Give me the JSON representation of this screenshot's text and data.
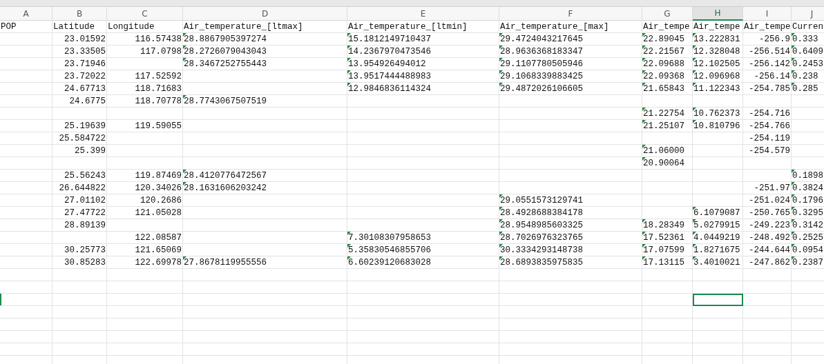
{
  "columns": [
    {
      "letter": "A",
      "heading": "POP",
      "text_numbers": false,
      "selected": false
    },
    {
      "letter": "B",
      "heading": "Latitude",
      "text_numbers": false,
      "selected": false
    },
    {
      "letter": "C",
      "heading": "Longitude",
      "text_numbers": false,
      "selected": false
    },
    {
      "letter": "D",
      "heading": "Air_temperature_[ltmax]",
      "text_numbers": true,
      "selected": false
    },
    {
      "letter": "E",
      "heading": "Air_temperature_[ltmin]",
      "text_numbers": true,
      "selected": false
    },
    {
      "letter": "F",
      "heading": "Air_temperature_[max]",
      "text_numbers": true,
      "selected": false
    },
    {
      "letter": "G",
      "heading": "Air_tempe",
      "text_numbers": true,
      "selected": false
    },
    {
      "letter": "H",
      "heading": "Air_tempe",
      "text_numbers": true,
      "selected": true
    },
    {
      "letter": "I",
      "heading": "Air_tempe",
      "text_numbers": false,
      "selected": false
    },
    {
      "letter": "J",
      "heading": "Curren",
      "text_numbers": true,
      "selected": false
    }
  ],
  "rows": [
    [
      null,
      "23.01592",
      "116.57438",
      "28.8867905397274",
      "15.1812149710437",
      "29.4724043217645",
      "22.89045",
      "13.222831",
      "-256.9",
      "0.333"
    ],
    [
      null,
      "23.33505",
      "117.0798",
      "28.2726079043043",
      "14.2367970473546",
      "28.9636368183347",
      "22.21567",
      "12.328048",
      "-256.514",
      "0.6409"
    ],
    [
      null,
      "23.71946",
      null,
      "28.3467252755443",
      "13.954926494012",
      "29.1107780505946",
      "22.09688",
      "12.102505",
      "-256.142",
      "0.2453"
    ],
    [
      null,
      "23.72022",
      "117.52592",
      null,
      "13.9517444488983",
      "29.1068339883425",
      "22.09368",
      "12.096968",
      "-256.14",
      "0.238"
    ],
    [
      null,
      "24.67713",
      "118.71683",
      null,
      "12.9846836114324",
      "29.4872026106605",
      "21.65843",
      "11.122343",
      "-254.785",
      "0.285"
    ],
    [
      null,
      "24.6775",
      "118.70778",
      "28.7743067507519",
      null,
      null,
      null,
      null,
      null,
      null
    ],
    [
      null,
      null,
      null,
      null,
      null,
      null,
      "21.22754",
      "10.762373",
      "-254.716",
      null
    ],
    [
      null,
      "25.19639",
      "119.59055",
      null,
      null,
      null,
      "21.25107",
      "10.810796",
      "-254.766",
      null
    ],
    [
      null,
      "25.584722",
      null,
      null,
      null,
      null,
      null,
      null,
      "-254.119",
      null
    ],
    [
      null,
      "25.399",
      null,
      null,
      null,
      null,
      "21.06000",
      null,
      "-254.579",
      null
    ],
    [
      null,
      null,
      null,
      null,
      null,
      null,
      "20.90064",
      null,
      null,
      null
    ],
    [
      null,
      "25.56243",
      "119.87469",
      "28.4120776472567",
      null,
      null,
      null,
      null,
      null,
      "0.1898"
    ],
    [
      null,
      "26.644822",
      "120.34026",
      "28.1631606203242",
      null,
      null,
      null,
      null,
      "-251.97",
      "0.3824"
    ],
    [
      null,
      "27.01102",
      "120.2686",
      null,
      null,
      "29.0551573129741",
      null,
      null,
      "-251.024",
      "0.1796"
    ],
    [
      null,
      "27.47722",
      "121.05028",
      null,
      null,
      "28.4928688384178",
      null,
      "6.1079087",
      "-250.765",
      "0.3295"
    ],
    [
      null,
      "28.89139",
      null,
      null,
      null,
      "28.9548985603325",
      "18.28349",
      "5.0279915",
      "-249.223",
      "0.3142"
    ],
    [
      null,
      null,
      "122.08587",
      null,
      "7.30108307958653",
      "28.7026976323765",
      "17.52361",
      "4.0449219",
      "-248.492",
      "0.2525"
    ],
    [
      null,
      "30.25773",
      "121.65069",
      null,
      "5.35830546855706",
      "30.3334293148738",
      "17.07599",
      "1.8271675",
      "-244.644",
      "0.0954"
    ],
    [
      null,
      "30.85283",
      "122.69978",
      "27.8678119955556",
      "6.60239120683028",
      "28.6893835975835",
      "17.13115",
      "3.4010021",
      "-247.862",
      "0.2387"
    ]
  ],
  "empty_rows": [
    {
      "selected": false
    },
    {
      "selected": false
    },
    {
      "selected": true
    },
    {
      "selected": false
    },
    {
      "selected": false
    },
    {
      "selected": false
    },
    {
      "selected": false
    },
    {
      "selected": false
    }
  ]
}
